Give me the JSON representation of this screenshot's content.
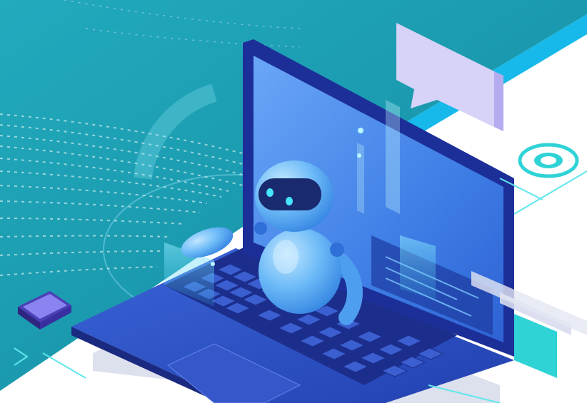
{
  "scene": {
    "subject": "robot-with-laptop-illustration",
    "style": "isometric",
    "colors": {
      "background_teal": "#1fa3b8",
      "background_teal_dark": "#178fa6",
      "stripe_blue": "#16b8e8",
      "laptop_blue": "#2a4fc4",
      "laptop_dark": "#1b2e8f",
      "screen_blue": "#4a8cf0",
      "robot_body": "#5ab4f5",
      "robot_visor": "#1a2a6e",
      "robot_eye": "#45e5ff",
      "chat_bubble": "#d6d2f8",
      "accent_cyan": "#36d6e0",
      "white": "#ffffff"
    },
    "icons": [
      "chat-bubble-icon",
      "target-ring-icon",
      "chip-icon",
      "robot-icon",
      "laptop-icon"
    ]
  }
}
